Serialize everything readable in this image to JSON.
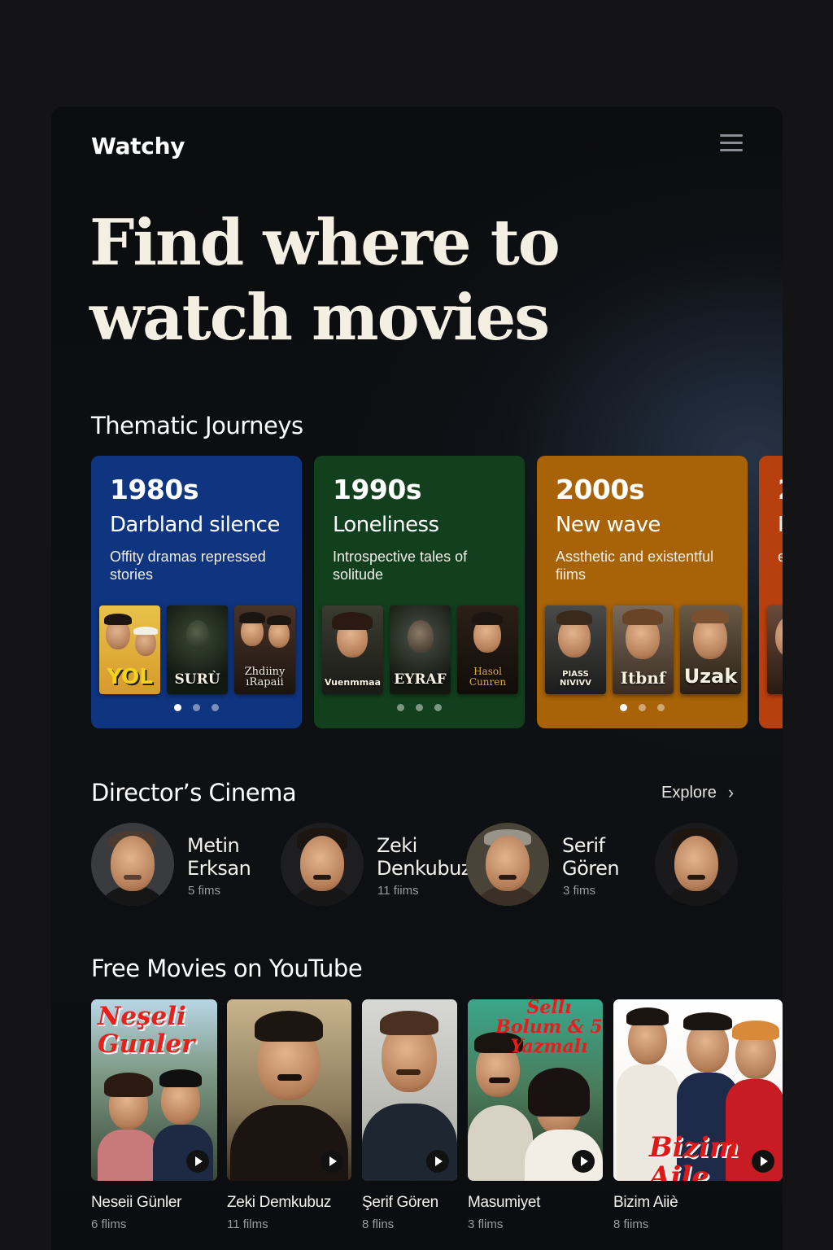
{
  "app": {
    "brand": "Watchy",
    "menu_icon": "hamburger-icon"
  },
  "hero": {
    "title": "Find where to watch movies"
  },
  "journeys": {
    "title": "Thematic Journeys",
    "cards": [
      {
        "decade": "1980s",
        "theme": "Darbland silence",
        "description": "Offity dramas repressed stories",
        "color": "#0f3580",
        "posters": [
          "YOL",
          "SURÙ",
          "Zhdiiny ıRapaii"
        ],
        "active_dot": 0
      },
      {
        "decade": "1990s",
        "theme": "Loneliness",
        "description": "Introspective tales of solitude",
        "color": "#12401f",
        "posters": [
          "Vuenmmaa",
          "EYRAF",
          "Hasol Cunren"
        ],
        "active_dot": -1
      },
      {
        "decade": "2000s",
        "theme": "New wave",
        "description": "Assthetic and existentful fiims",
        "color": "#a86208",
        "posters": [
          "PIASS NIVIVV",
          "Itbnf",
          "Uzak"
        ],
        "active_dot": 0
      },
      {
        "decade": "2",
        "theme": "I",
        "description": "e e",
        "color": "#b8400f",
        "posters": [],
        "active_dot": -1
      }
    ]
  },
  "directors": {
    "title": "Director’s Cinema",
    "explore_label": "Explore",
    "items": [
      {
        "name": "Metin Erksan",
        "count": "5 fims"
      },
      {
        "name": "Zeki Denkubuz",
        "count": "11 fiims"
      },
      {
        "name": "Serif Gören",
        "count": "3 fims"
      },
      {
        "name": "",
        "count": ""
      }
    ]
  },
  "youtube": {
    "title": "Free Movies on YouTube",
    "items": [
      {
        "title": "Neseii Günler",
        "count": "6 flims",
        "overlay": "Neşeli Gunler"
      },
      {
        "title": "Zeki Demkubuz",
        "count": "11 films",
        "overlay": ""
      },
      {
        "title": "Şerif Gören",
        "count": "8 flins",
        "overlay": ""
      },
      {
        "title": "Masumiyet",
        "count": "3 flims",
        "overlay": "Sellı Bolum & 5 Yazmalı"
      },
      {
        "title": "Bizim Aiiè",
        "count": "8 fiims",
        "overlay": "Bizim Aile"
      }
    ]
  }
}
